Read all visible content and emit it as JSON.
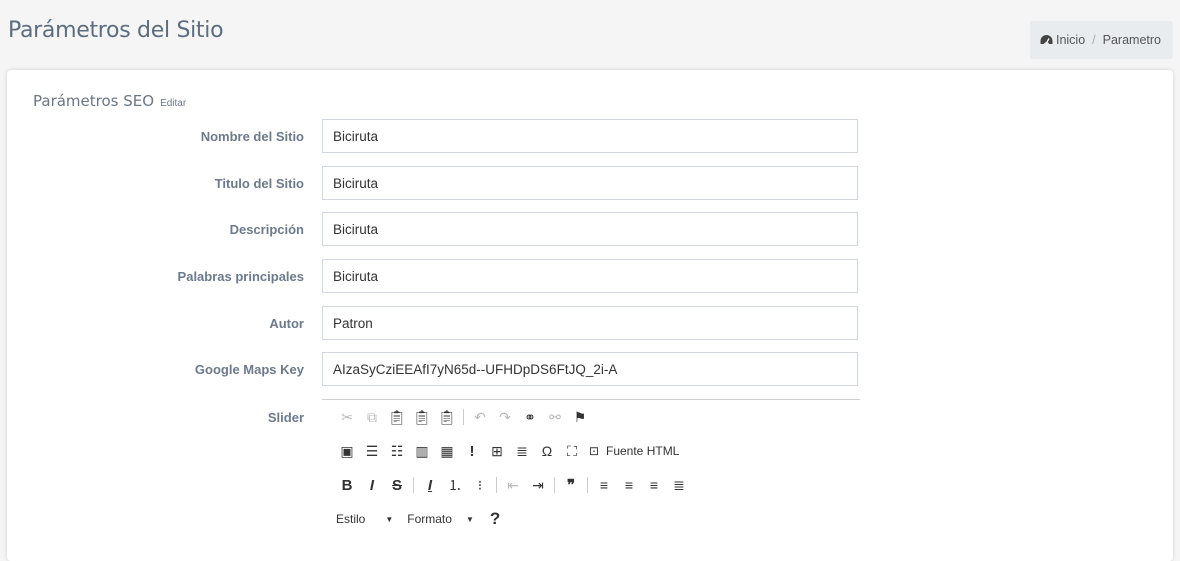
{
  "page": {
    "title": "Parámetros del Sitio"
  },
  "breadcrumb": {
    "home_label": "Inicio",
    "separator": "/",
    "current": "Parametro"
  },
  "card": {
    "title": "Parámetros SEO",
    "subtitle": "Editar"
  },
  "form": {
    "fields": [
      {
        "label": "Nombre del Sitio",
        "value": "Biciruta"
      },
      {
        "label": "Titulo del Sitio",
        "value": "Biciruta"
      },
      {
        "label": "Descripción",
        "value": "Biciruta"
      },
      {
        "label": "Palabras principales",
        "value": "Biciruta"
      },
      {
        "label": "Autor",
        "value": "Patron"
      },
      {
        "label": "Google Maps Key",
        "value": "AIzaSyCziEEAfI7yN65d--UFHDpDS6FtJQ_2i-A"
      }
    ],
    "slider_label": "Slider"
  },
  "editor": {
    "source_label": "Fuente HTML",
    "style_combo": "Estilo",
    "format_combo": "Formato",
    "help_label": "?",
    "toolbar_row1": [
      "cut-icon",
      "copy-icon",
      "paste-icon",
      "paste-text-icon",
      "paste-word-icon",
      "undo-icon",
      "redo-icon",
      "link-icon",
      "unlink-icon",
      "anchor-icon"
    ],
    "toolbar_row2": [
      "image-icon",
      "flash-icon",
      "iframe-icon",
      "columns-icon",
      "grid-icon",
      "exclamation-icon",
      "table-icon",
      "horizontal-rule-icon",
      "special-char-icon",
      "maximize-icon",
      "source-icon"
    ],
    "toolbar_row3": [
      "bold-icon",
      "italic-icon",
      "strike-icon",
      "remove-format-icon",
      "numbered-list-icon",
      "bulleted-list-icon",
      "outdent-icon",
      "indent-icon",
      "blockquote-icon",
      "align-left-icon",
      "align-center-icon",
      "align-right-icon",
      "justify-icon"
    ]
  },
  "colors": {
    "title": "#5c6d7f",
    "label": "#6c7a8c",
    "background": "#f5f5f5",
    "breadcrumb_bg": "#e9ecef"
  }
}
